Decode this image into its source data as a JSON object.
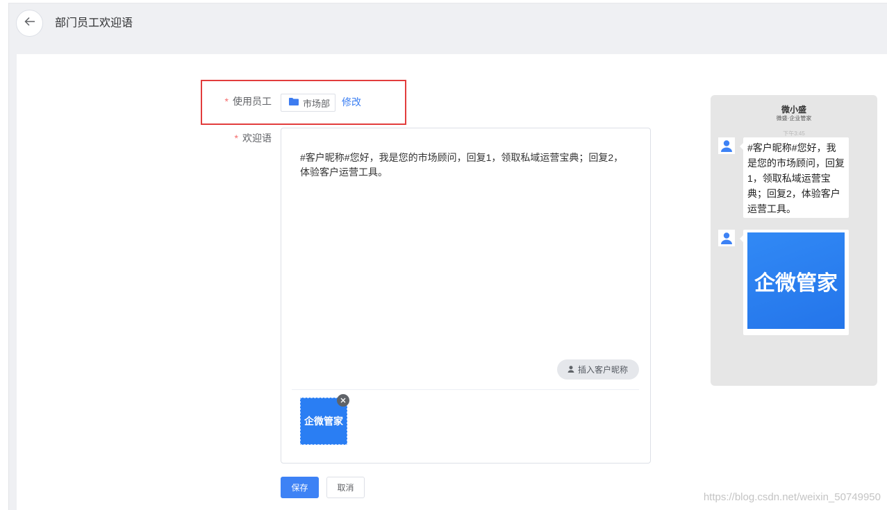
{
  "header": {
    "back_icon": "arrow-left-icon",
    "title": "部门员工欢迎语"
  },
  "form": {
    "employee": {
      "required_mark": "*",
      "label": "使用员工",
      "department_icon": "folder-icon",
      "department": "市场部",
      "modify_link": "修改"
    },
    "welcome": {
      "required_mark": "*",
      "label": "欢迎语",
      "message_lines": [
        "#客户昵称#您好，我是您的市场顾问，回复1，领取私域运营宝典；回复2，",
        "体验客户运营工具。"
      ],
      "insert_nickname": {
        "icon": "person-icon",
        "label": "插入客户昵称"
      },
      "attachment": {
        "image_text": "企微管家",
        "remove_icon": "close-icon"
      }
    },
    "actions": {
      "save_label": "保存",
      "cancel_label": "取消"
    }
  },
  "preview": {
    "contact_name": "微小盛",
    "contact_subtitle": "微盛·企业管家",
    "time": "下午3:45",
    "avatar_icon": "user-avatar-icon",
    "text_message_lines": [
      "#客户昵称#您好，我",
      "是您的市场顾问，回复",
      "1，领取私域运营宝",
      "典；回复2，体验客户",
      "运营工具。"
    ],
    "image_message_text": "企微管家"
  },
  "colors": {
    "accent": "#3a7ef2",
    "required": "#f56c6c",
    "image_blue": "#2a7ef3",
    "panel_gray": "#e6e6e6",
    "highlight": "#e23c3c"
  },
  "watermark": "https://blog.csdn.net/weixin_50749950"
}
